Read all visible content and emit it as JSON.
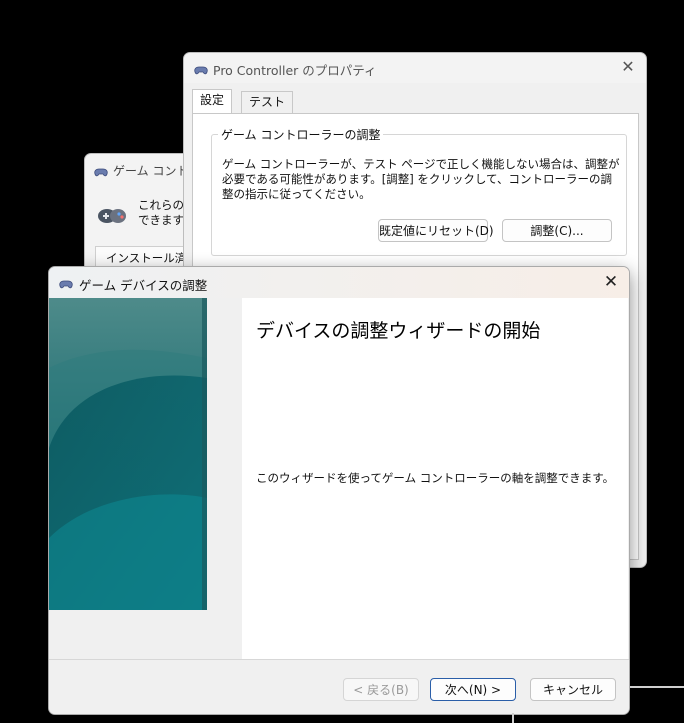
{
  "back_window": {
    "title": "ゲーム コントロー",
    "description_line1": "これらの設",
    "description_line2": "できます。",
    "list_header": "インストール済み"
  },
  "props_window": {
    "title": "Pro Controller のプロパティ",
    "tabs": [
      "設定",
      "テスト"
    ],
    "active_tab": "設定",
    "group": {
      "legend": "ゲーム コントローラーの調整",
      "text": "ゲーム コントローラーが、テスト ページで正しく機能しない場合は、調整が必要である可能性があります。[調整] をクリックして、コントローラーの調整の指示に従ってください。"
    },
    "reset_button": "既定値にリセット(D)",
    "calibrate_button": "調整(C)..."
  },
  "wizard": {
    "title": "ゲーム デバイスの調整",
    "heading": "デバイスの調整ウィザードの開始",
    "description": "このウィザードを使ってゲーム コントローラーの軸を調整できます。",
    "back_button": "< 戻る(B)",
    "next_button": "次へ(N) >",
    "cancel_button": "キャンセル",
    "back_enabled": false
  },
  "colors": {
    "banner_dark": "#0b5a62",
    "banner_light": "#3f8a8c",
    "primary_border": "#2a5ea8"
  },
  "icons": {
    "window": "gamepad-icon",
    "close": "close-icon"
  }
}
